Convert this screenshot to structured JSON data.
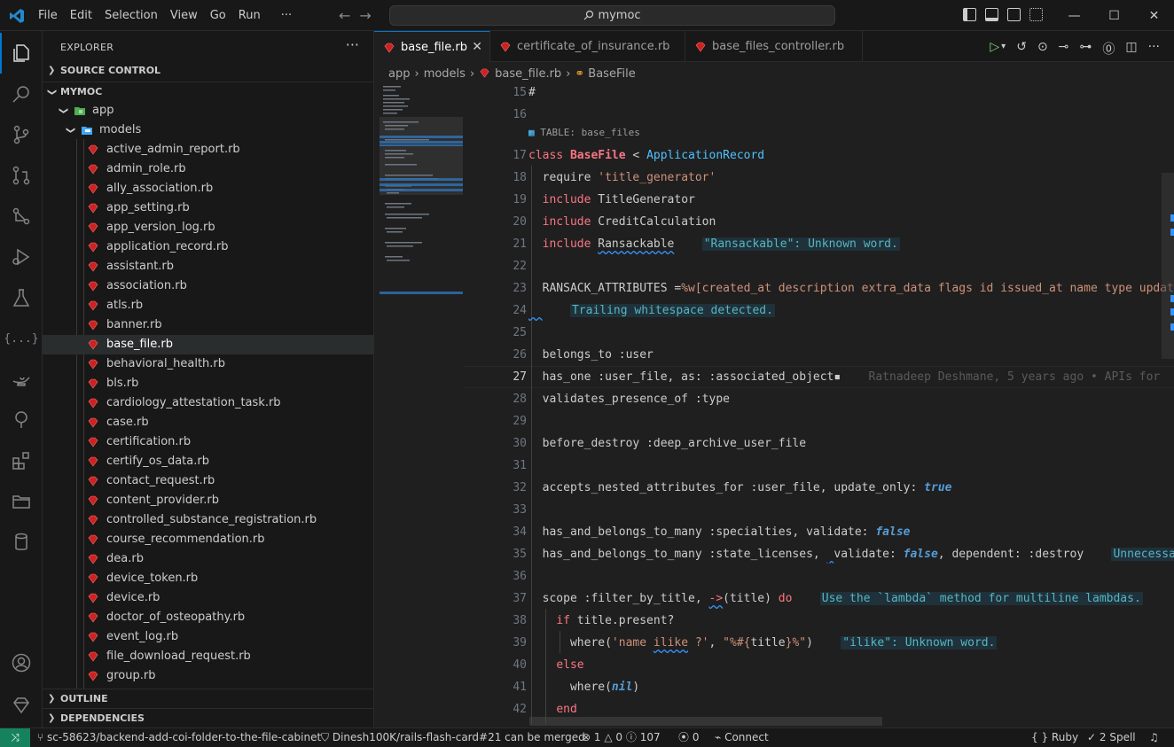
{
  "titlebar": {
    "menu": [
      "File",
      "Edit",
      "Selection",
      "View",
      "Go",
      "Run",
      "···"
    ],
    "search": "mymoc"
  },
  "sidebar": {
    "title": "EXPLORER",
    "dots": "···",
    "source_control": "SOURCE CONTROL",
    "project": "MYMOC",
    "folder_app": "app",
    "folder_models": "models",
    "files": [
      "active_admin_report.rb",
      "admin_role.rb",
      "ally_association.rb",
      "app_setting.rb",
      "app_version_log.rb",
      "application_record.rb",
      "assistant.rb",
      "association.rb",
      "atls.rb",
      "banner.rb",
      "base_file.rb",
      "behavioral_health.rb",
      "bls.rb",
      "cardiology_attestation_task.rb",
      "case.rb",
      "certification.rb",
      "certify_os_data.rb",
      "contact_request.rb",
      "content_provider.rb",
      "controlled_substance_registration.rb",
      "course_recommendation.rb",
      "dea.rb",
      "device_token.rb",
      "device.rb",
      "doctor_of_osteopathy.rb",
      "event_log.rb",
      "file_download_request.rb",
      "group.rb"
    ],
    "outline": "OUTLINE",
    "dependencies": "DEPENDENCIES"
  },
  "tabs": [
    {
      "label": "base_file.rb",
      "active": true
    },
    {
      "label": "certificate_of_insurance.rb",
      "active": false
    },
    {
      "label": "base_files_controller.rb",
      "active": false
    }
  ],
  "breadcrumb": [
    "app",
    "models",
    "base_file.rb",
    "BaseFile"
  ],
  "editor": {
    "table_hint": "TABLE: base_files",
    "line_numbers": [
      "15",
      "16",
      "17",
      "18",
      "19",
      "20",
      "21",
      "22",
      "23",
      "24",
      "25",
      "26",
      "27",
      "28",
      "29",
      "30",
      "31",
      "32",
      "33",
      "34",
      "35",
      "36",
      "37",
      "38",
      "39",
      "40",
      "41",
      "42"
    ],
    "diag_ransackable": "\"Ransackable\": Unknown word.",
    "diag_trailing": "Trailing whitespace detected.",
    "blame": "Ratnadeep Deshmane, 5 years ago • APIs for",
    "diag_unnecessary": "Unnecessar",
    "diag_lambda": "Use the `lambda` method for multiline lambdas.",
    "diag_ilike": "\"ilike\": Unknown word."
  },
  "statusbar": {
    "branch": "sc-58623/backend-add-coi-folder-to-the-file-cabinet",
    "pr": "Dinesh100K/rails-flash-card#21 can be merged",
    "errors": "1",
    "warnings": "0",
    "infos": "107",
    "ports": "0",
    "connect": "Connect",
    "language": "Ruby",
    "spell": "2 Spell"
  },
  "colors": {
    "accent": "#0078d4",
    "remote": "#16825d",
    "ruby": "#cc2222"
  }
}
